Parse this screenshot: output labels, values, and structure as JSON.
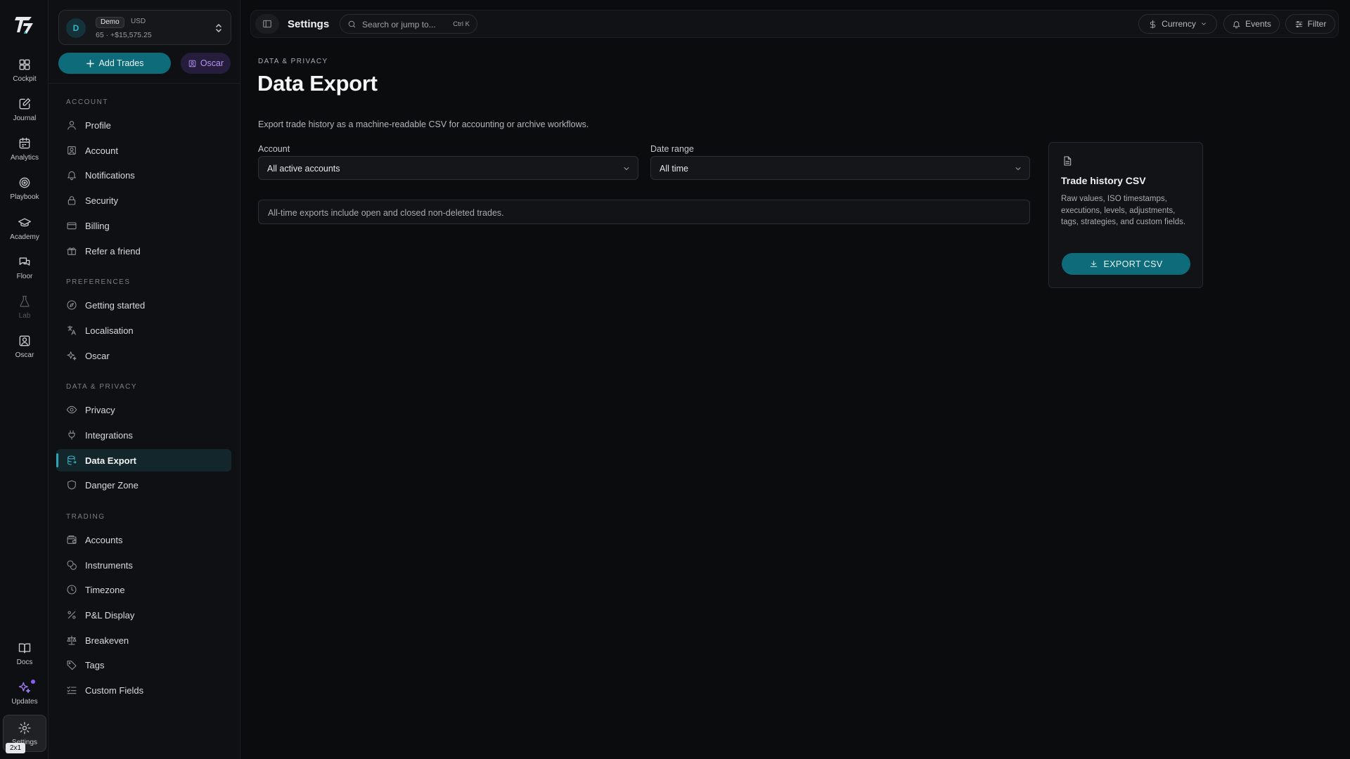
{
  "rail": {
    "items": [
      {
        "label": "Cockpit"
      },
      {
        "label": "Journal"
      },
      {
        "label": "Analytics"
      },
      {
        "label": "Playbook"
      },
      {
        "label": "Academy"
      },
      {
        "label": "Floor"
      },
      {
        "label": "Lab"
      },
      {
        "label": "Oscar"
      }
    ],
    "bottom": [
      {
        "label": "Docs"
      },
      {
        "label": "Updates"
      },
      {
        "label": "Settings"
      }
    ],
    "scale_badge": "2x1"
  },
  "account_switcher": {
    "avatar": "D",
    "tag": "Demo",
    "currency": "USD",
    "summary": "65 · +$15,575.25"
  },
  "actions": {
    "add_trades": "Add Trades",
    "oscar": "Oscar"
  },
  "nav": {
    "sections": [
      {
        "title": "ACCOUNT",
        "items": [
          {
            "label": "Profile"
          },
          {
            "label": "Account"
          },
          {
            "label": "Notifications"
          },
          {
            "label": "Security"
          },
          {
            "label": "Billing"
          },
          {
            "label": "Refer a friend"
          }
        ]
      },
      {
        "title": "PREFERENCES",
        "items": [
          {
            "label": "Getting started"
          },
          {
            "label": "Localisation"
          },
          {
            "label": "Oscar"
          }
        ]
      },
      {
        "title": "DATA & PRIVACY",
        "items": [
          {
            "label": "Privacy"
          },
          {
            "label": "Integrations"
          },
          {
            "label": "Data Export",
            "active": true
          },
          {
            "label": "Danger Zone"
          }
        ]
      },
      {
        "title": "TRADING",
        "items": [
          {
            "label": "Accounts"
          },
          {
            "label": "Instruments"
          },
          {
            "label": "Timezone"
          },
          {
            "label": "P&L Display"
          },
          {
            "label": "Breakeven"
          },
          {
            "label": "Tags"
          },
          {
            "label": "Custom Fields"
          }
        ]
      }
    ]
  },
  "topbar": {
    "title": "Settings",
    "search_placeholder": "Search or jump to...",
    "search_shortcut": "Ctrl K",
    "currency": "Currency",
    "events": "Events",
    "filter": "Filter"
  },
  "page": {
    "eyebrow": "DATA & PRIVACY",
    "title": "Data Export",
    "description": "Export trade history as a machine-readable CSV for accounting or archive workflows.",
    "account_label": "Account",
    "account_value": "All active accounts",
    "date_range_label": "Date range",
    "date_range_value": "All time",
    "info": "All-time exports include open and closed non-deleted trades.",
    "card": {
      "title": "Trade history CSV",
      "description": "Raw values, ISO timestamps, executions, levels, adjustments, tags, strategies, and custom fields.",
      "button": "EXPORT CSV"
    }
  },
  "colors": {
    "accent": "#0e6b7a",
    "accent_light": "#3ab3c5",
    "oscar_purple": "#b393f6",
    "background": "#0b0c0e"
  }
}
